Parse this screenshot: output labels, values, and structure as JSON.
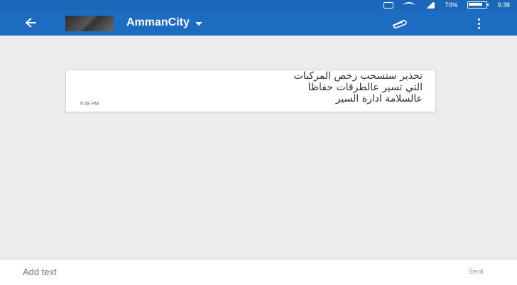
{
  "status_bar": {
    "battery_text": "70%",
    "time": "9:38",
    "icons": [
      "notification-icon",
      "wifi-icon",
      "signal-icon",
      "battery-icon"
    ]
  },
  "toolbar": {
    "contact_name": "AmmanCity",
    "icons": [
      "back-arrow-icon",
      "caret-down-icon",
      "paperclip-icon",
      "overflow-menu-icon"
    ],
    "color": "#1c6cc2"
  },
  "messages": [
    {
      "text": "تحذير ستسحب رخص المركبات\nالتي تسير عالطرقات حفاظا\nعالسلامة ادارة السير",
      "time": "9:38 PM"
    }
  ],
  "composer": {
    "placeholder": "Add text",
    "send_label": "Send"
  }
}
